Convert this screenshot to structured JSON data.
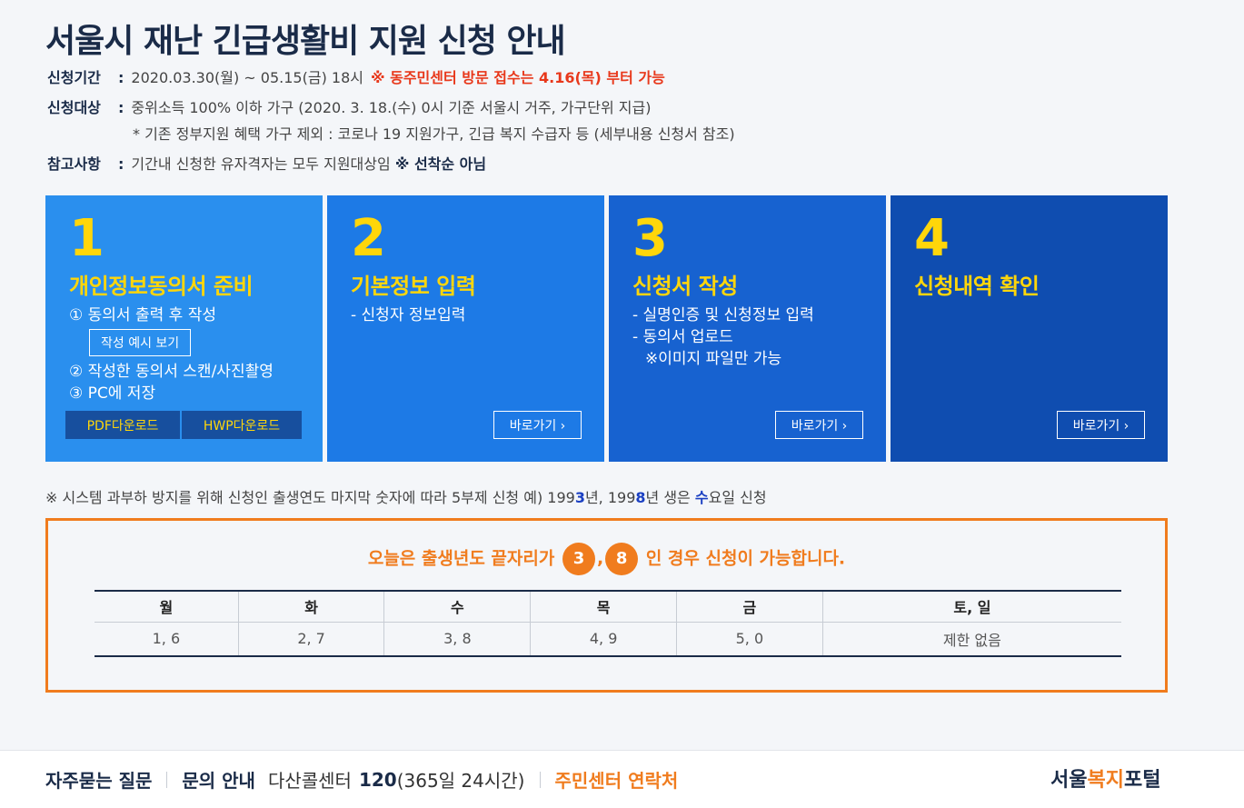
{
  "title": "서울시 재난 긴급생활비 지원 신청 안내",
  "info": {
    "period_label": "신청기간",
    "period_value": "2020.03.30(월) ~ 05.15(금) 18시",
    "period_notice": "※ 동주민센터 방문 접수는 4.16(목) 부터 가능",
    "target_label": "신청대상",
    "target_value": "중위소득 100% 이하 가구 (2020. 3. 18.(수) 0시 기준 서울시 거주, 가구단위 지급)",
    "target_sub": "* 기존 정부지원 혜택 가구 제외 : 코로나 19 지원가구, 긴급 복지 수급자 등 (세부내용 신청서 참조)",
    "ref_label": "참고사항",
    "ref_value": "기간내 신청한 유자격자는 모두 지원대상임",
    "ref_strong": "※ 선착순 아님",
    "colon": ":"
  },
  "steps": [
    {
      "num": "1",
      "title": "개인정보동의서 준비",
      "line1": "① 동의서 출력 후 작성",
      "example_btn": "작성 예시 보기",
      "line2": "② 작성한 동의서 스캔/사진촬영",
      "line3": "③ PC에 저장",
      "pdf_btn": "PDF다운로드",
      "hwp_btn": "HWP다운로드"
    },
    {
      "num": "2",
      "title": "기본정보 입력",
      "line1": "- 신청자 정보입력",
      "go_btn": "바로가기 ›"
    },
    {
      "num": "3",
      "title": "신청서 작성",
      "line1": "- 실명인증 및 신청정보 입력",
      "line2": "- 동의서 업로드",
      "line3": "※이미지 파일만 가능",
      "go_btn": "바로가기 ›"
    },
    {
      "num": "4",
      "title": "신청내역 확인",
      "go_btn": "바로가기 ›"
    }
  ],
  "note": {
    "text_a": "※ 시스템 과부하 방지를 위해 신청인 출생연도 마지막 숫자에 따라 5부제 신청 예) 199",
    "d1": "3",
    "text_b": "년, 199",
    "d2": "8",
    "text_c": "년 생은 ",
    "day": "수",
    "text_d": "요일 신청"
  },
  "today": {
    "msg_a": "오늘은 출생년도 끝자리가",
    "digit1": "3",
    "comma": ",",
    "digit2": "8",
    "msg_b": "인 경우 신청이 가능합니다.",
    "headers": [
      "월",
      "화",
      "수",
      "목",
      "금",
      "토, 일"
    ],
    "values": [
      "1, 6",
      "2, 7",
      "3, 8",
      "4, 9",
      "5, 0",
      "제한 없음"
    ]
  },
  "footer": {
    "faq": "자주묻는 질문",
    "contact": "문의 안내",
    "callcenter": "다산콜센터",
    "number": "120",
    "hours": "(365일 24시간)",
    "center_contact": "주민센터 연락처",
    "logo_a": "서울",
    "logo_b": "복지",
    "logo_c": "포털"
  },
  "colors": {
    "accent_orange": "#f07c1e",
    "notice_red": "#e8381b",
    "navy": "#1a2b48",
    "step_yellow": "#ffd60a"
  }
}
